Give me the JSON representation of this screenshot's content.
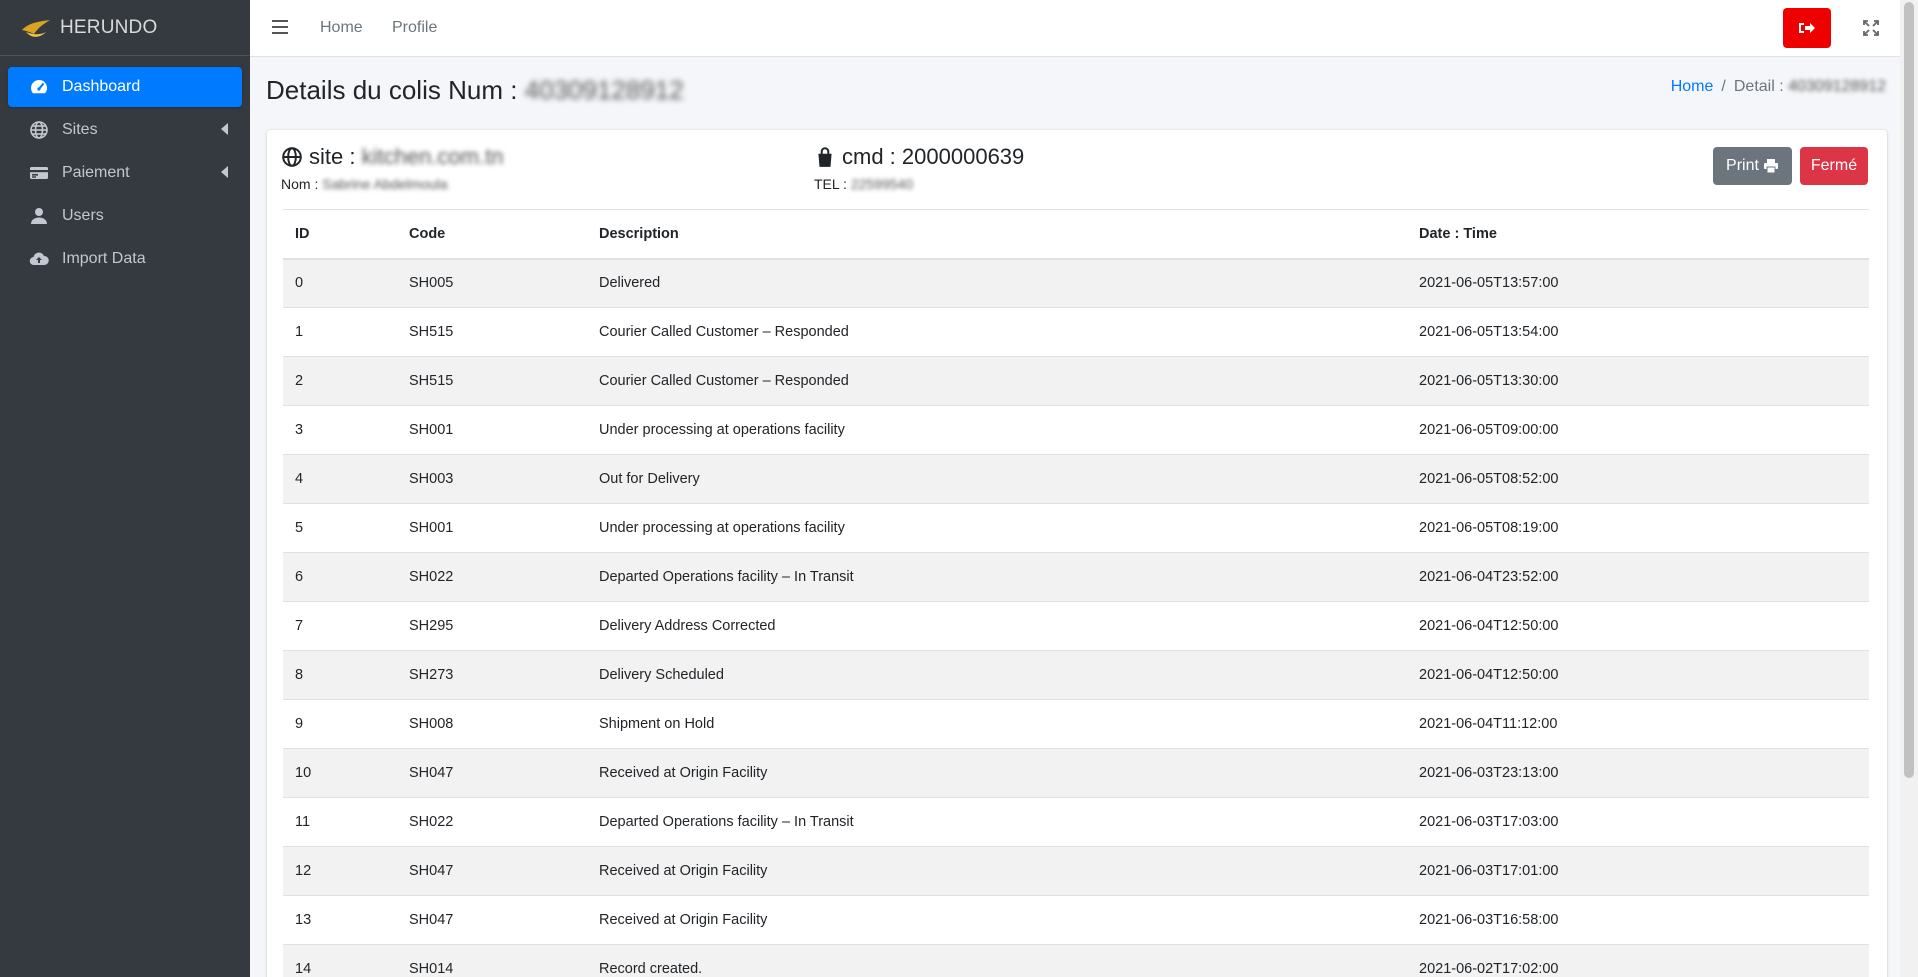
{
  "brand": {
    "name": "HERUNDO"
  },
  "sidebar": {
    "items": [
      {
        "label": "Dashboard",
        "icon": "tachometer-icon",
        "active": true
      },
      {
        "label": "Sites",
        "icon": "globe-icon",
        "has_submenu": true
      },
      {
        "label": "Paiement",
        "icon": "credit-card-icon",
        "has_submenu": true
      },
      {
        "label": "Users",
        "icon": "user-icon"
      },
      {
        "label": "Import Data",
        "icon": "cloud-upload-icon"
      }
    ]
  },
  "topbar": {
    "links": [
      "Home",
      "Profile"
    ],
    "logout_icon": "sign-out-icon",
    "fullscreen_icon": "expand-icon",
    "accent": "#ee0000"
  },
  "page": {
    "title_prefix": "Details du colis Num :",
    "title_value": "40309128912",
    "breadcrumb": {
      "home": "Home",
      "current_prefix": "Detail :",
      "current_value": "40309128912"
    }
  },
  "details": {
    "site_prefix": "site :",
    "site_value": "kitchen.com.tn",
    "name_prefix": "Nom :",
    "name_value": "Sabrine Abdelmoula",
    "cmd_prefix": "cmd :",
    "cmd_value": "2000000639",
    "tel_prefix": "TEL :",
    "tel_value": "22599540"
  },
  "actions": {
    "print": "Print",
    "close": "Fermé"
  },
  "table": {
    "headers": [
      "ID",
      "Code",
      "Description",
      "Date : Time"
    ],
    "rows": [
      [
        "0",
        "SH005",
        "Delivered",
        "2021-06-05T13:57:00"
      ],
      [
        "1",
        "SH515",
        "Courier Called Customer – Responded",
        "2021-06-05T13:54:00"
      ],
      [
        "2",
        "SH515",
        "Courier Called Customer – Responded",
        "2021-06-05T13:30:00"
      ],
      [
        "3",
        "SH001",
        "Under processing at operations facility",
        "2021-06-05T09:00:00"
      ],
      [
        "4",
        "SH003",
        "Out for Delivery",
        "2021-06-05T08:52:00"
      ],
      [
        "5",
        "SH001",
        "Under processing at operations facility",
        "2021-06-05T08:19:00"
      ],
      [
        "6",
        "SH022",
        "Departed Operations facility – In Transit",
        "2021-06-04T23:52:00"
      ],
      [
        "7",
        "SH295",
        "Delivery Address Corrected",
        "2021-06-04T12:50:00"
      ],
      [
        "8",
        "SH273",
        "Delivery Scheduled",
        "2021-06-04T12:50:00"
      ],
      [
        "9",
        "SH008",
        "Shipment on Hold",
        "2021-06-04T11:12:00"
      ],
      [
        "10",
        "SH047",
        "Received at Origin Facility",
        "2021-06-03T23:13:00"
      ],
      [
        "11",
        "SH022",
        "Departed Operations facility – In Transit",
        "2021-06-03T17:03:00"
      ],
      [
        "12",
        "SH047",
        "Received at Origin Facility",
        "2021-06-03T17:01:00"
      ],
      [
        "13",
        "SH047",
        "Received at Origin Facility",
        "2021-06-03T16:58:00"
      ],
      [
        "14",
        "SH014",
        "Record created.",
        "2021-06-02T17:02:00"
      ]
    ]
  }
}
